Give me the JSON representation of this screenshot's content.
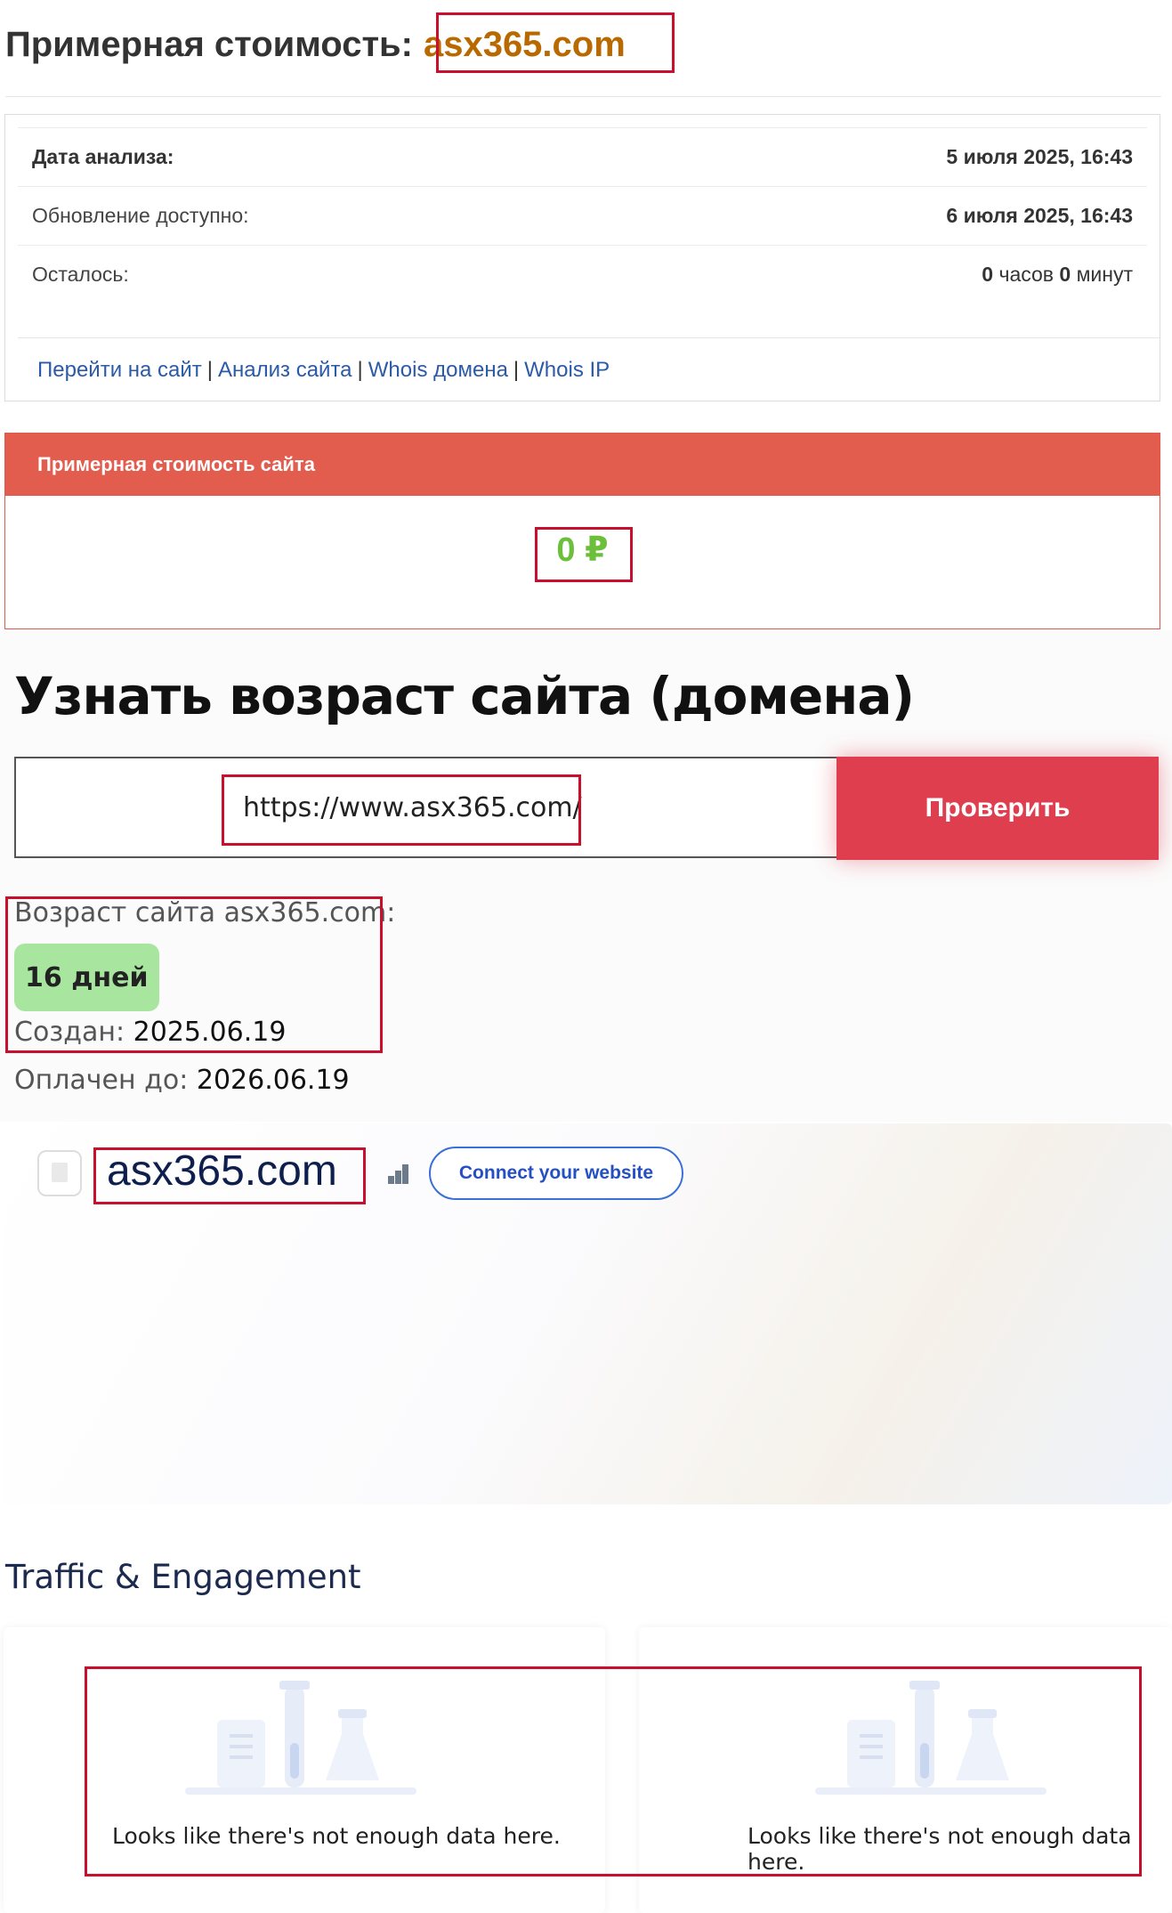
{
  "header": {
    "title": "Примерная стоимость:",
    "domain": "asx365.com"
  },
  "info": {
    "rows": [
      {
        "label": "Дата анализа:",
        "value": "5 июля 2025, 16:43"
      },
      {
        "label": "Обновление доступно:",
        "value": "6 июля 2025, 16:43"
      },
      {
        "label": "Осталось:",
        "value_num1": "0",
        "value_unit1": "часов",
        "value_num2": "0",
        "value_unit2": "минут"
      }
    ],
    "links": [
      "Перейти на сайт",
      "Анализ сайта",
      "Whois домена",
      "Whois IP"
    ],
    "separator": "|"
  },
  "value_card": {
    "heading": "Примерная стоимость сайта",
    "amount": "0 ₽"
  },
  "age_check": {
    "title": "Узнать возраст сайта (домена)",
    "input_value": "https://www.asx365.com/",
    "button_label": "Проверить",
    "result_label": "Возраст сайта asx365.com:",
    "age_badge": "16 дней",
    "created_label": "Создан:",
    "created_value": "2025.06.19",
    "paid_label": "Оплачен до:",
    "paid_value": "2026.06.19"
  },
  "site_card": {
    "domain": "asx365.com",
    "connect_label": "Connect your website",
    "fav_icon": "document-icon",
    "rank_icon": "bar-rank-icon"
  },
  "traffic": {
    "title": "Traffic & Engagement",
    "panels": [
      {
        "message": "Looks like there's not enough data here."
      },
      {
        "message": "Looks like there's not enough data here."
      }
    ]
  },
  "colors": {
    "highlight": "#c8102e",
    "value_header": "#e35d4f",
    "value_amount": "#6cbf3a",
    "check_button": "#df3e4f",
    "age_badge": "#a8e6a0",
    "domain_accent": "#b86a00",
    "link": "#2b5aa8",
    "connect": "#2450c4"
  }
}
